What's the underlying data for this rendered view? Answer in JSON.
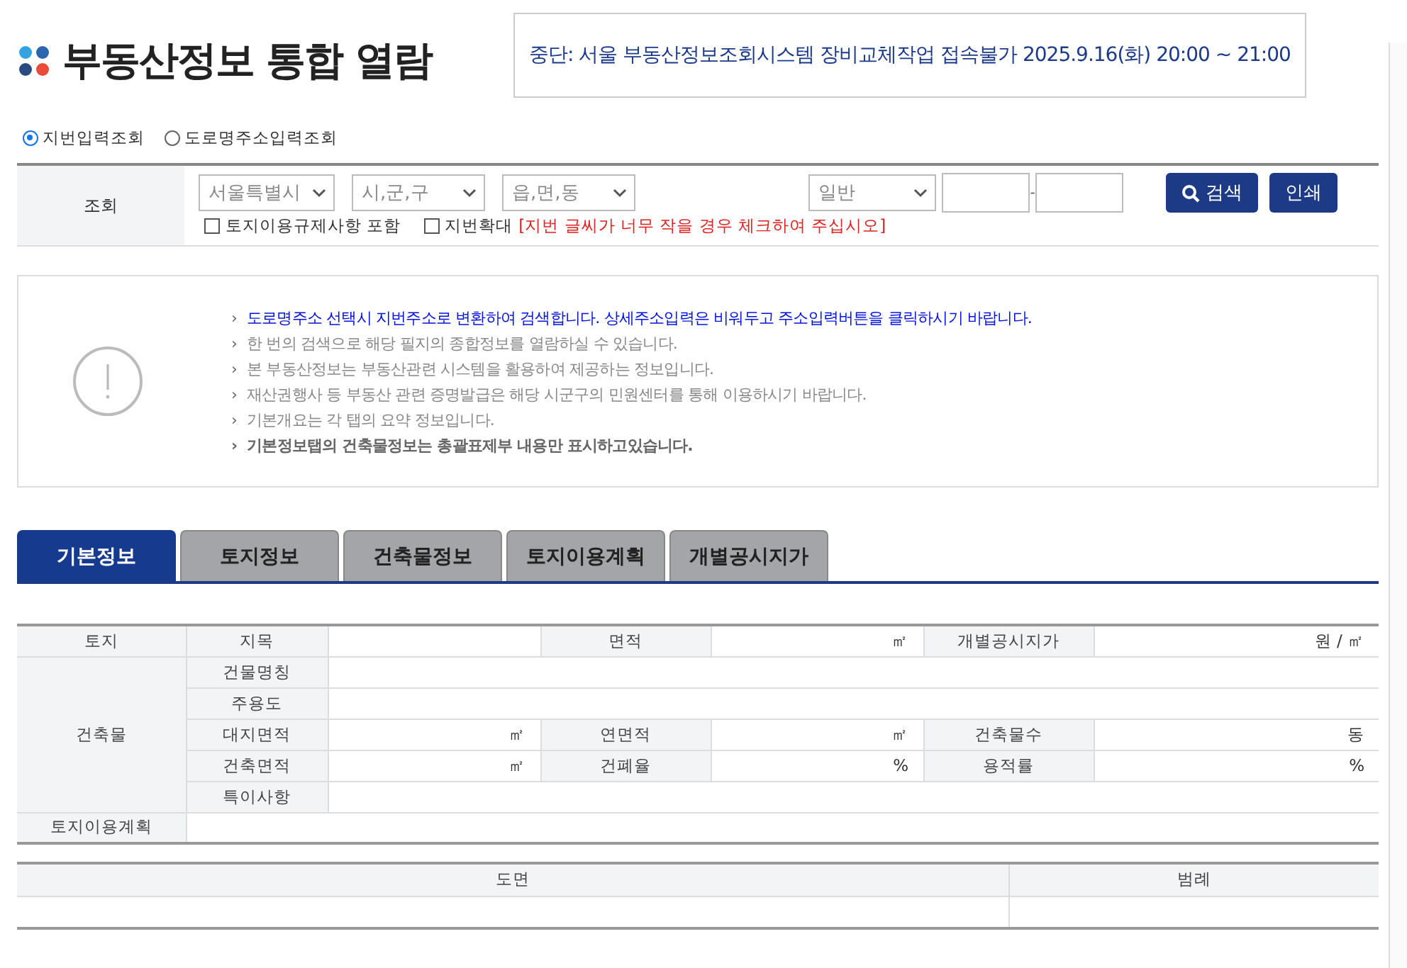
{
  "title": "부동산정보 통합 열람",
  "notice": "중단: 서울 부동산정보조회시스템 장비교체작업 접속불가 2025.9.16(화) 20:00 ~ 21:00",
  "search_modes": [
    {
      "label": "지번입력조회",
      "selected": true
    },
    {
      "label": "도로명주소입력조회",
      "selected": false
    }
  ],
  "search": {
    "label": "조회",
    "selects": [
      {
        "value": "서울특별시"
      },
      {
        "value": "시,군,구"
      },
      {
        "value": "읍,면,동"
      },
      {
        "value": "일반"
      }
    ],
    "number_separator": "-",
    "checkboxes": [
      {
        "label": "토지이용규제사항 포함",
        "checked": false
      },
      {
        "label": "지번확대",
        "checked": false,
        "note": "[지번 글씨가 너무 작을 경우 체크하여 주십시오]"
      }
    ],
    "buttons": [
      {
        "label": "검색",
        "kind": "search"
      },
      {
        "label": "인쇄",
        "kind": "print"
      }
    ]
  },
  "info": [
    {
      "text": "도로명주소 선택시 지번주소로 변환하여 검색합니다. 상세주소입력은 비워두고 주소입력버튼을 클릭하시기 바랍니다.",
      "kind": "highlight"
    },
    {
      "text": "한 번의 검색으로 해당 필지의 종합정보를 열람하실 수 있습니다.",
      "kind": "normal"
    },
    {
      "text": "본 부동산정보는 부동산관련 시스템을 활용하여 제공하는 정보입니다.",
      "kind": "normal"
    },
    {
      "text": "재산권행사 등 부동산 관련 증명발급은 해당 시군구의 민원센터를 통해 이용하시기 바랍니다.",
      "kind": "normal"
    },
    {
      "text": "기본개요는 각 탭의 요약 정보입니다.",
      "kind": "normal"
    },
    {
      "text": "기본정보탭의 건축물정보는 총괄표제부 내용만 표시하고있습니다.",
      "kind": "bold"
    }
  ],
  "info_bullet": "›",
  "tabs": [
    {
      "label": "기본정보",
      "selected": true
    },
    {
      "label": "토지정보",
      "selected": false
    },
    {
      "label": "건축물정보",
      "selected": false
    },
    {
      "label": "토지이용계획",
      "selected": false
    },
    {
      "label": "개별공시지가",
      "selected": false
    }
  ],
  "info_table": [
    {
      "header": "토지",
      "rows": [
        [
          {
            "label": "지목"
          },
          {
            "label": "면적",
            "unit": "㎡"
          },
          {
            "label": "개별공시지가",
            "unit": "원 / ㎡"
          }
        ]
      ]
    },
    {
      "header": "건축물",
      "rows": [
        [
          {
            "label": "건물명칭"
          }
        ],
        [
          {
            "label": "주용도"
          }
        ],
        [
          {
            "label": "대지면적",
            "unit": "㎡"
          },
          {
            "label": "연면적",
            "unit": "㎡"
          },
          {
            "label": "건축물수",
            "unit": "동"
          }
        ],
        [
          {
            "label": "건축면적",
            "unit": "㎡"
          },
          {
            "label": "건폐율",
            "unit": "%"
          },
          {
            "label": "용적률",
            "unit": "%"
          }
        ],
        [
          {
            "label": "특이사항"
          }
        ]
      ]
    },
    {
      "header": "토지이용계획"
    }
  ],
  "drawing_table": {
    "columns": [
      "도면",
      "범례"
    ]
  }
}
